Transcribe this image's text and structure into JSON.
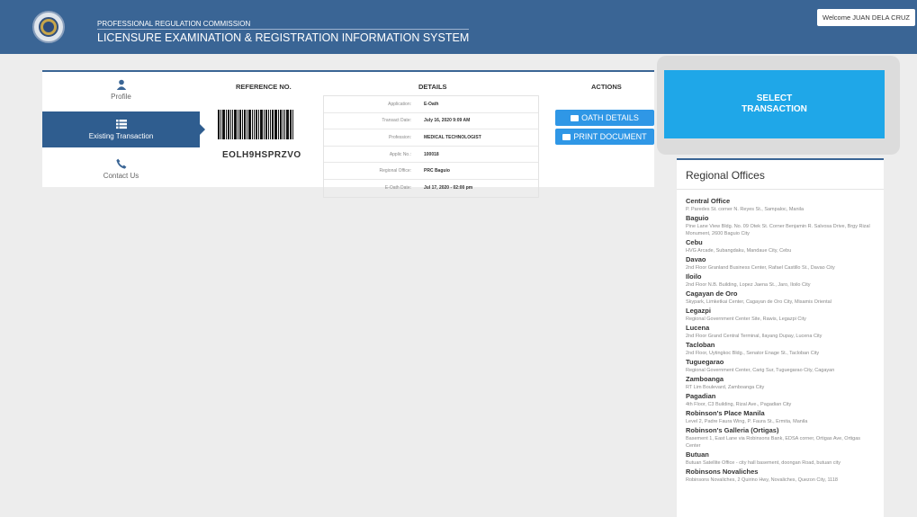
{
  "header": {
    "org": "PROFESSIONAL REGULATION COMMISSION",
    "system": "LICENSURE EXAMINATION & REGISTRATION INFORMATION SYSTEM",
    "welcome": "Welcome JUAN DELA CRUZ"
  },
  "sidebar": {
    "items": [
      {
        "label": "Profile",
        "icon": "user-icon"
      },
      {
        "label": "Existing Transaction",
        "icon": "list-icon"
      },
      {
        "label": "Contact Us",
        "icon": "phone-icon"
      }
    ]
  },
  "columns": {
    "reference": "REFERENCE NO.",
    "details": "DETAILS",
    "actions": "ACTIONS"
  },
  "reference_no": "EOLH9HSPRZVO",
  "details": [
    {
      "label": "Application:",
      "value": "E-Oath"
    },
    {
      "label": "Transact Date:",
      "value": "July 16, 2020 9:09 AM"
    },
    {
      "label": "Profession:",
      "value": "MEDICAL TECHNOLOGIST"
    },
    {
      "label": "Applic No.:",
      "value": "100018"
    },
    {
      "label": "Regional Office:",
      "value": "PRC Baguio"
    },
    {
      "label": "E-Oath Date:",
      "value": "Jul 17, 2020 - 02:00 pm"
    }
  ],
  "actions": {
    "oath": "OATH DETAILS",
    "print": "PRINT DOCUMENT"
  },
  "select_transaction": "SELECT\nTRANSACTION",
  "regional": {
    "title": "Regional Offices",
    "offices": [
      {
        "name": "Central Office",
        "address": "P. Paredes St. corner N. Reyes St., Sampaloc, Manila"
      },
      {
        "name": "Baguio",
        "address": "Pine Lane View Bldg. No. 09 Otek St. Corner Benjamin R. Salvosa Drive, Brgy Rizal Monument, 2600 Baguio City"
      },
      {
        "name": "Cebu",
        "address": "HVG Arcade, Subangdaku, Mandaue City, Cebu"
      },
      {
        "name": "Davao",
        "address": "2nd Floor Granland Business Center, Rafael Castillo St., Davao City"
      },
      {
        "name": "Iloilo",
        "address": "2nd Floor N.B. Building, Lopez Jaena St., Jaro, Iloilo City"
      },
      {
        "name": "Cagayan de Oro",
        "address": "Skypark, Limketkai Center, Cagayan de Oro City, Misamis Oriental"
      },
      {
        "name": "Legazpi",
        "address": "Regional Government Center Site, Rawis, Legazpi City"
      },
      {
        "name": "Lucena",
        "address": "2nd Floor Grand Central Terminal, Ilayang Dupay, Lucena City"
      },
      {
        "name": "Tacloban",
        "address": "2nd Floor, Uytingkoc Bldg., Senator Enage St., Tacloban City"
      },
      {
        "name": "Tuguegarao",
        "address": "Regional Government Center, Carig Sur, Tuguegarao City, Cagayan"
      },
      {
        "name": "Zamboanga",
        "address": "RT Lim Boulevard, Zamboanga City"
      },
      {
        "name": "Pagadian",
        "address": "4th Floor, C3 Building, Rizal Ave., Pagadian City"
      },
      {
        "name": "Robinson's Place Manila",
        "address": "Level 2, Padre Faura Wing, P. Faura St., Ermita, Manila"
      },
      {
        "name": "Robinson's Galleria (Ortigas)",
        "address": "Basement 1, East Lane via Robinsons Bank, EDSA corner, Ortigas Ave, Ortigas Center"
      },
      {
        "name": "Butuan",
        "address": "Butuan Satellite Office - city hall basement, doongan Road, butuan city"
      },
      {
        "name": "Robinsons Novaliches",
        "address": "Robinsons Novaliches, 2 Quirino Hwy, Novaliches, Quezon City, 1118"
      }
    ]
  }
}
